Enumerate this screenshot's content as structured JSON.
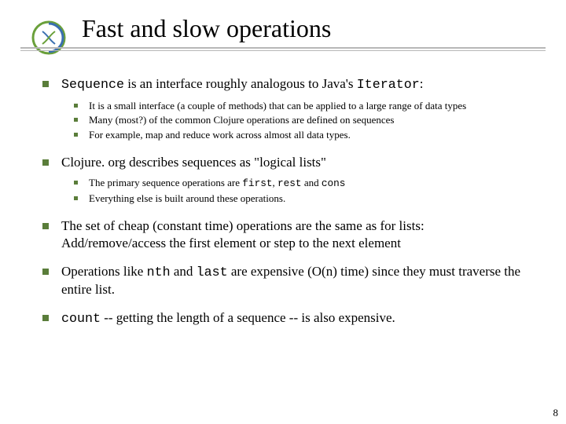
{
  "title": "Fast and slow operations",
  "b1": {
    "pre": "Sequence",
    "mid": " is an interface roughly analogous to Java's ",
    "post": "Iterator",
    "tail": ":"
  },
  "b1s": {
    "a": "It is a small interface (a couple of methods) that can be applied to a large range of data types",
    "b": "Many (most?) of the common Clojure operations are defined on sequences",
    "c": "For example, map and reduce work across almost all data types."
  },
  "b2": "Clojure. org describes sequences as \"logical lists\"",
  "b2s": {
    "a_pre": " The primary sequence operations are ",
    "a_c1": "first",
    "a_m1": ", ",
    "a_c2": "rest",
    "a_m2": " and ",
    "a_c3": "cons",
    "b": "Everything else is built around these operations."
  },
  "b3": "The set of cheap (constant time) operations are the same as for lists: Add/remove/access the first element or step to the next element",
  "b4": {
    "pre": "Operations like ",
    "c1": "nth",
    "mid": " and ",
    "c2": "last",
    "post": " are expensive (O(n) time) since they must traverse the entire list."
  },
  "b5": {
    "c": "count",
    "post": " -- getting the length of a sequence -- is also expensive."
  },
  "pagenum": "8"
}
